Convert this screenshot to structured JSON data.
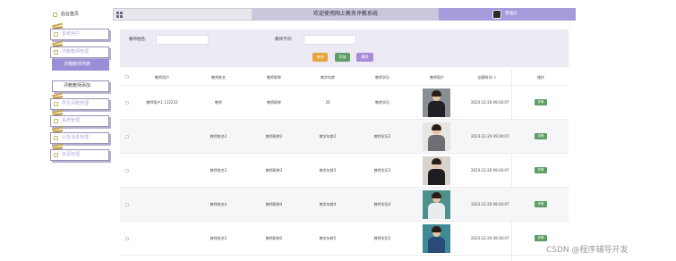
{
  "sidebar": {
    "items": [
      {
        "label": "后台首页"
      },
      {
        "label": "系统用户"
      },
      {
        "label": "评教教师管理"
      },
      {
        "label": "评教教师列表"
      },
      {
        "label": "评教教师添加"
      },
      {
        "label": "学生评教管理"
      },
      {
        "label": "系统管理"
      },
      {
        "label": "公告消息管理"
      },
      {
        "label": "资源管理"
      }
    ]
  },
  "header": {
    "title": "欢迎使用网上教务评教系统",
    "username": "管理员"
  },
  "search": {
    "name_label": "教师姓名:",
    "id_label": "教师学识:",
    "search_btn": "查询",
    "add_btn": "添加",
    "delete_btn": "删除"
  },
  "table": {
    "columns": [
      "教师用户",
      "教师姓名",
      "教师职称",
      "教学年龄",
      "教师学历",
      "教师照片",
      "创建时间",
      "操作"
    ],
    "rows": [
      {
        "user": "教师用户1 112233",
        "name": "教师",
        "title": "教师职称",
        "age": "20",
        "degree": "教师学历",
        "created": "2023-12-20 09:30:07",
        "action": "评教"
      },
      {
        "user": "",
        "name": "教师姓名2",
        "title": "教师职称2",
        "age": "教学年龄2",
        "degree": "教师学历2",
        "created": "2023-12-20 09:30:07",
        "action": "评教"
      },
      {
        "user": "",
        "name": "教师姓名3",
        "title": "教师职称3",
        "age": "教学年龄3",
        "degree": "教师学历3",
        "created": "2023-12-20 09:30:07",
        "action": "评教"
      },
      {
        "user": "",
        "name": "教师姓名4",
        "title": "教师职称4",
        "age": "教学年龄4",
        "degree": "教师学历4",
        "created": "2023-12-20 09:30:07",
        "action": "评教"
      },
      {
        "user": "",
        "name": "教师姓名5",
        "title": "教师职称5",
        "age": "教学年龄5",
        "degree": "教师学历5",
        "created": "2023-12-20 09:30:07",
        "action": "评教"
      }
    ]
  },
  "watermark": "CSDN @程序辅导开发",
  "colors": {
    "accent": "#a79bdc",
    "active_nav": "#9a8ed6",
    "search_btn": "#e8a33a",
    "add_btn": "#5e9f65",
    "delete_btn": "#a98cd8"
  }
}
